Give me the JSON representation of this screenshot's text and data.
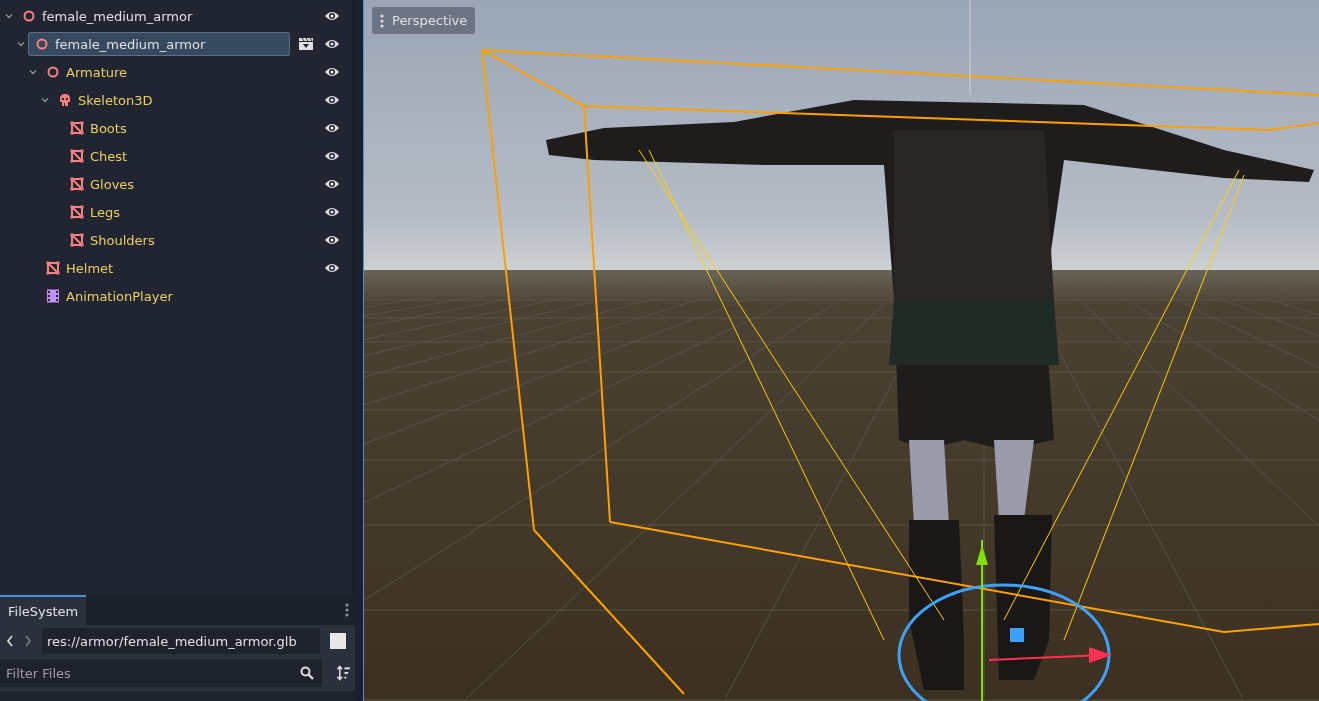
{
  "scene_tree": {
    "nodes": [
      {
        "name": "female_medium_armor",
        "kind": "node3d",
        "expanded": true,
        "selected": false,
        "eye": true,
        "scene_icon": false,
        "children": [
          {
            "name": "female_medium_armor",
            "kind": "node3d",
            "expanded": true,
            "selected": true,
            "eye": true,
            "scene_icon": true,
            "children": [
              {
                "name": "Armature",
                "kind": "node3d",
                "expanded": true,
                "selected": false,
                "eye": true,
                "scene_icon": false,
                "children": [
                  {
                    "name": "Skeleton3D",
                    "kind": "skeleton",
                    "expanded": true,
                    "selected": false,
                    "eye": true,
                    "scene_icon": false,
                    "children": [
                      {
                        "name": "Boots",
                        "kind": "mesh",
                        "selected": false,
                        "eye": true,
                        "scene_icon": false
                      },
                      {
                        "name": "Chest",
                        "kind": "mesh",
                        "selected": false,
                        "eye": true,
                        "scene_icon": false
                      },
                      {
                        "name": "Gloves",
                        "kind": "mesh",
                        "selected": false,
                        "eye": true,
                        "scene_icon": false
                      },
                      {
                        "name": "Legs",
                        "kind": "mesh",
                        "selected": false,
                        "eye": true,
                        "scene_icon": false
                      },
                      {
                        "name": "Shoulders",
                        "kind": "mesh",
                        "selected": false,
                        "eye": true,
                        "scene_icon": false
                      }
                    ]
                  }
                ]
              },
              {
                "name": "Helmet",
                "kind": "mesh",
                "selected": false,
                "eye": true,
                "scene_icon": false
              },
              {
                "name": "AnimationPlayer",
                "kind": "animation",
                "selected": false,
                "eye": false,
                "scene_icon": false
              }
            ]
          }
        ]
      }
    ]
  },
  "filesystem": {
    "tab": "FileSystem",
    "path": "res://armor/female_medium_armor.glb",
    "filter": {
      "placeholder": "Filter Files"
    }
  },
  "viewport": {
    "view_menu": "Perspective"
  }
}
